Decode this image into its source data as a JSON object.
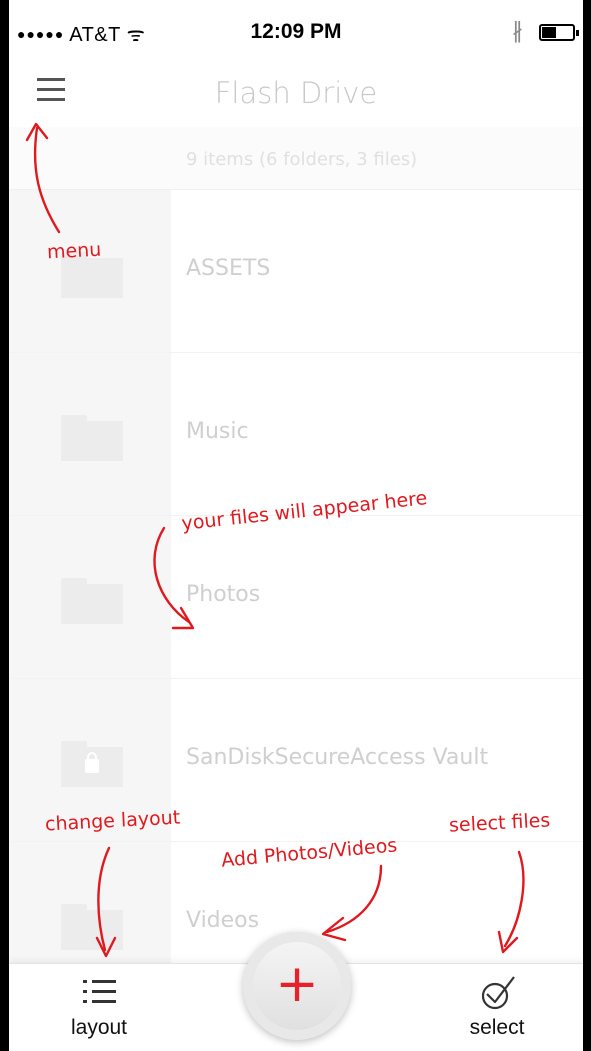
{
  "status_bar": {
    "signal": "●●●●●",
    "carrier": "AT&T",
    "wifi": "ᯤ",
    "time": "12:09 PM",
    "bluetooth": "∦"
  },
  "nav": {
    "title": "Flash Drive"
  },
  "summary": "9 items (6 folders, 3 files)",
  "items": [
    {
      "name": "ASSETS",
      "icon": "folder-icon"
    },
    {
      "name": "Music",
      "icon": "folder-icon"
    },
    {
      "name": "Photos",
      "icon": "folder-icon"
    },
    {
      "name": "SanDiskSecureAccess Vault",
      "icon": "locked-folder-icon"
    },
    {
      "name": "Videos",
      "icon": "folder-icon"
    }
  ],
  "toolbar": {
    "layout_label": "layout",
    "add_symbol": "+",
    "select_label": "select"
  },
  "annotations": {
    "menu": "menu",
    "files": "your files will appear here",
    "layout": "change layout",
    "add": "Add Photos/Videos",
    "select": "select files"
  },
  "colors": {
    "annotation": "#e0191f",
    "add_plus": "#e8202a"
  }
}
